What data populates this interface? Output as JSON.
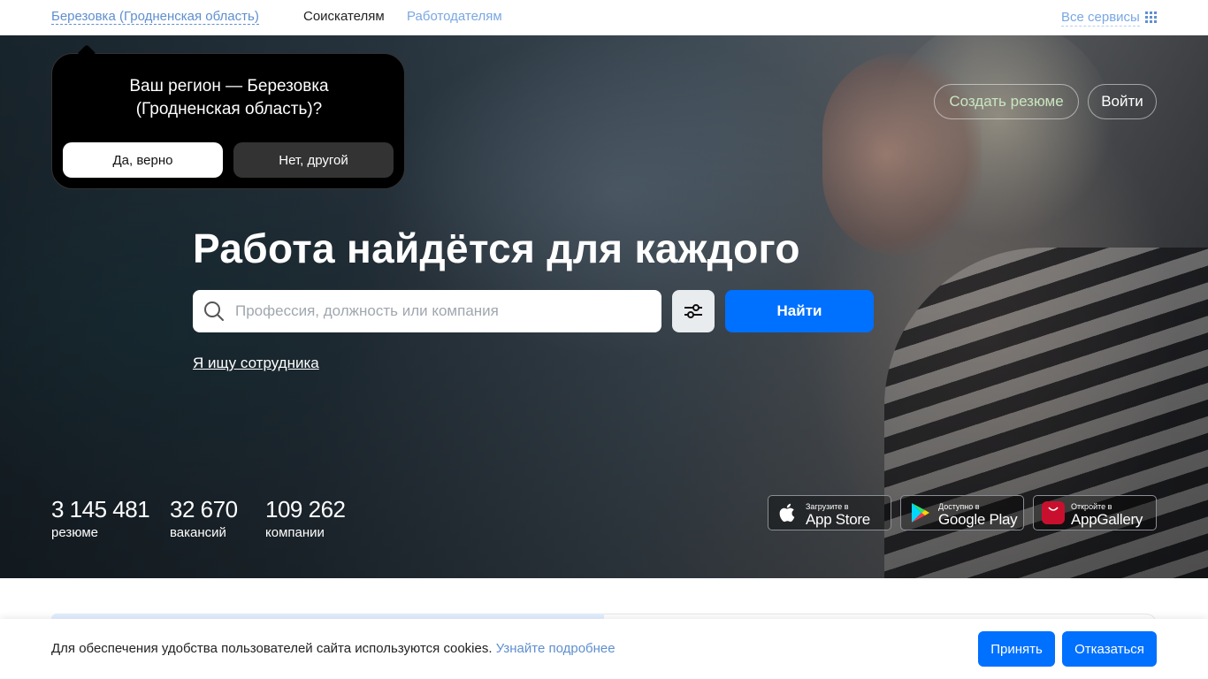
{
  "topbar": {
    "region": "Березовка (Гродненская область)",
    "nav_jobseekers": "Соискателям",
    "nav_employers": "Работодателям",
    "all_services": "Все сервисы"
  },
  "region_popup": {
    "question": "Ваш регион — Березовка (Гродненская область)?",
    "yes_label": "Да, верно",
    "no_label": "Нет, другой"
  },
  "header": {
    "create_resume": "Создать резюме",
    "login": "Войти"
  },
  "hero": {
    "headline": "Работа найдётся для каждого",
    "search_placeholder": "Профессия, должность или компания",
    "find_label": "Найти",
    "employer_link": "Я ищу сотрудника"
  },
  "stats": [
    {
      "value": "3 145 481",
      "label": "резюме"
    },
    {
      "value": "32 670",
      "label": "вакансий"
    },
    {
      "value": "109 262",
      "label": "компании"
    }
  ],
  "app_badges": [
    {
      "small": "Загрузите в",
      "big": "App Store",
      "icon": "apple-icon"
    },
    {
      "small": "Доступно в",
      "big": "Google Play",
      "icon": "google-play-icon"
    },
    {
      "small": "Откройте в",
      "big": "AppGallery",
      "icon": "huawei-icon"
    }
  ],
  "cookie": {
    "text": "Для обеспечения удобства пользователей сайта используются cookies.",
    "more": "Узнайте подробнее",
    "accept": "Принять",
    "decline": "Отказаться"
  },
  "colors": {
    "accent": "#0070ff",
    "link": "#5f8fcf"
  }
}
